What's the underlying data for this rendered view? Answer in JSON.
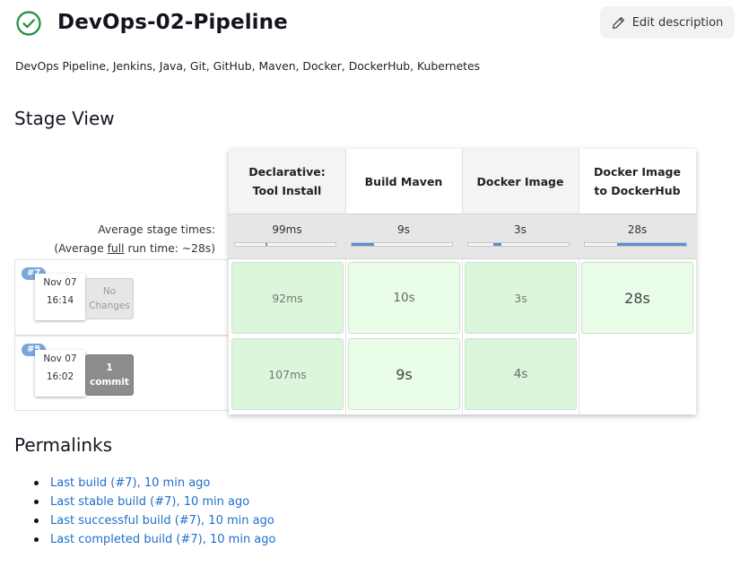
{
  "header": {
    "title": "DevOps-02-Pipeline",
    "status_icon": "success-check-circle-icon",
    "status_color": "#1e8e3e",
    "edit_label": "Edit description",
    "description": "DevOps Pipeline, Jenkins, Java, Git, GitHub, Maven, Docker, DockerHub, Kubernetes"
  },
  "stage_view": {
    "title": "Stage View",
    "avg_label_line1": "Average stage times:",
    "avg_label_prefix": "(Average ",
    "avg_label_full": "full",
    "avg_label_suffix": " run time: ~28s)",
    "stages": [
      {
        "name_line1": "Declarative:",
        "name_line2": "Tool Install",
        "avg": "99ms",
        "bar": {
          "start": 0.3,
          "fraction": 0.02
        }
      },
      {
        "name_line1": "Build Maven",
        "name_line2": "",
        "avg": "9s",
        "bar": {
          "start": 0.0,
          "fraction": 0.22
        }
      },
      {
        "name_line1": "Docker Image",
        "name_line2": "",
        "avg": "3s",
        "bar": {
          "start": 0.25,
          "fraction": 0.08
        }
      },
      {
        "name_line1": "Docker Image",
        "name_line2": "to DockerHub",
        "avg": "28s",
        "bar": {
          "start": 0.32,
          "fraction": 0.68
        }
      }
    ],
    "builds": [
      {
        "number": "#7",
        "date": "Nov 07",
        "time": "16:14",
        "changes_line1": "No",
        "changes_line2": "Changes",
        "durations": [
          "92ms",
          "10s",
          "3s",
          "28s"
        ]
      },
      {
        "number": "#5",
        "date": "Nov 07",
        "time": "16:02",
        "changes_line1": "1",
        "changes_line2": "commit",
        "durations": [
          "107ms",
          "9s",
          "4s",
          ""
        ]
      }
    ]
  },
  "permalinks": {
    "title": "Permalinks",
    "links": [
      "Last build (#7), 10 min ago",
      "Last stable build (#7), 10 min ago",
      "Last successful build (#7), 10 min ago",
      "Last completed build (#7), 10 min ago"
    ]
  },
  "colors": {
    "link": "#1f6fc9",
    "success_cell": "#dbf6db",
    "build_badge": "#7aa6dc",
    "avg_bar": "#5a8ed6"
  }
}
